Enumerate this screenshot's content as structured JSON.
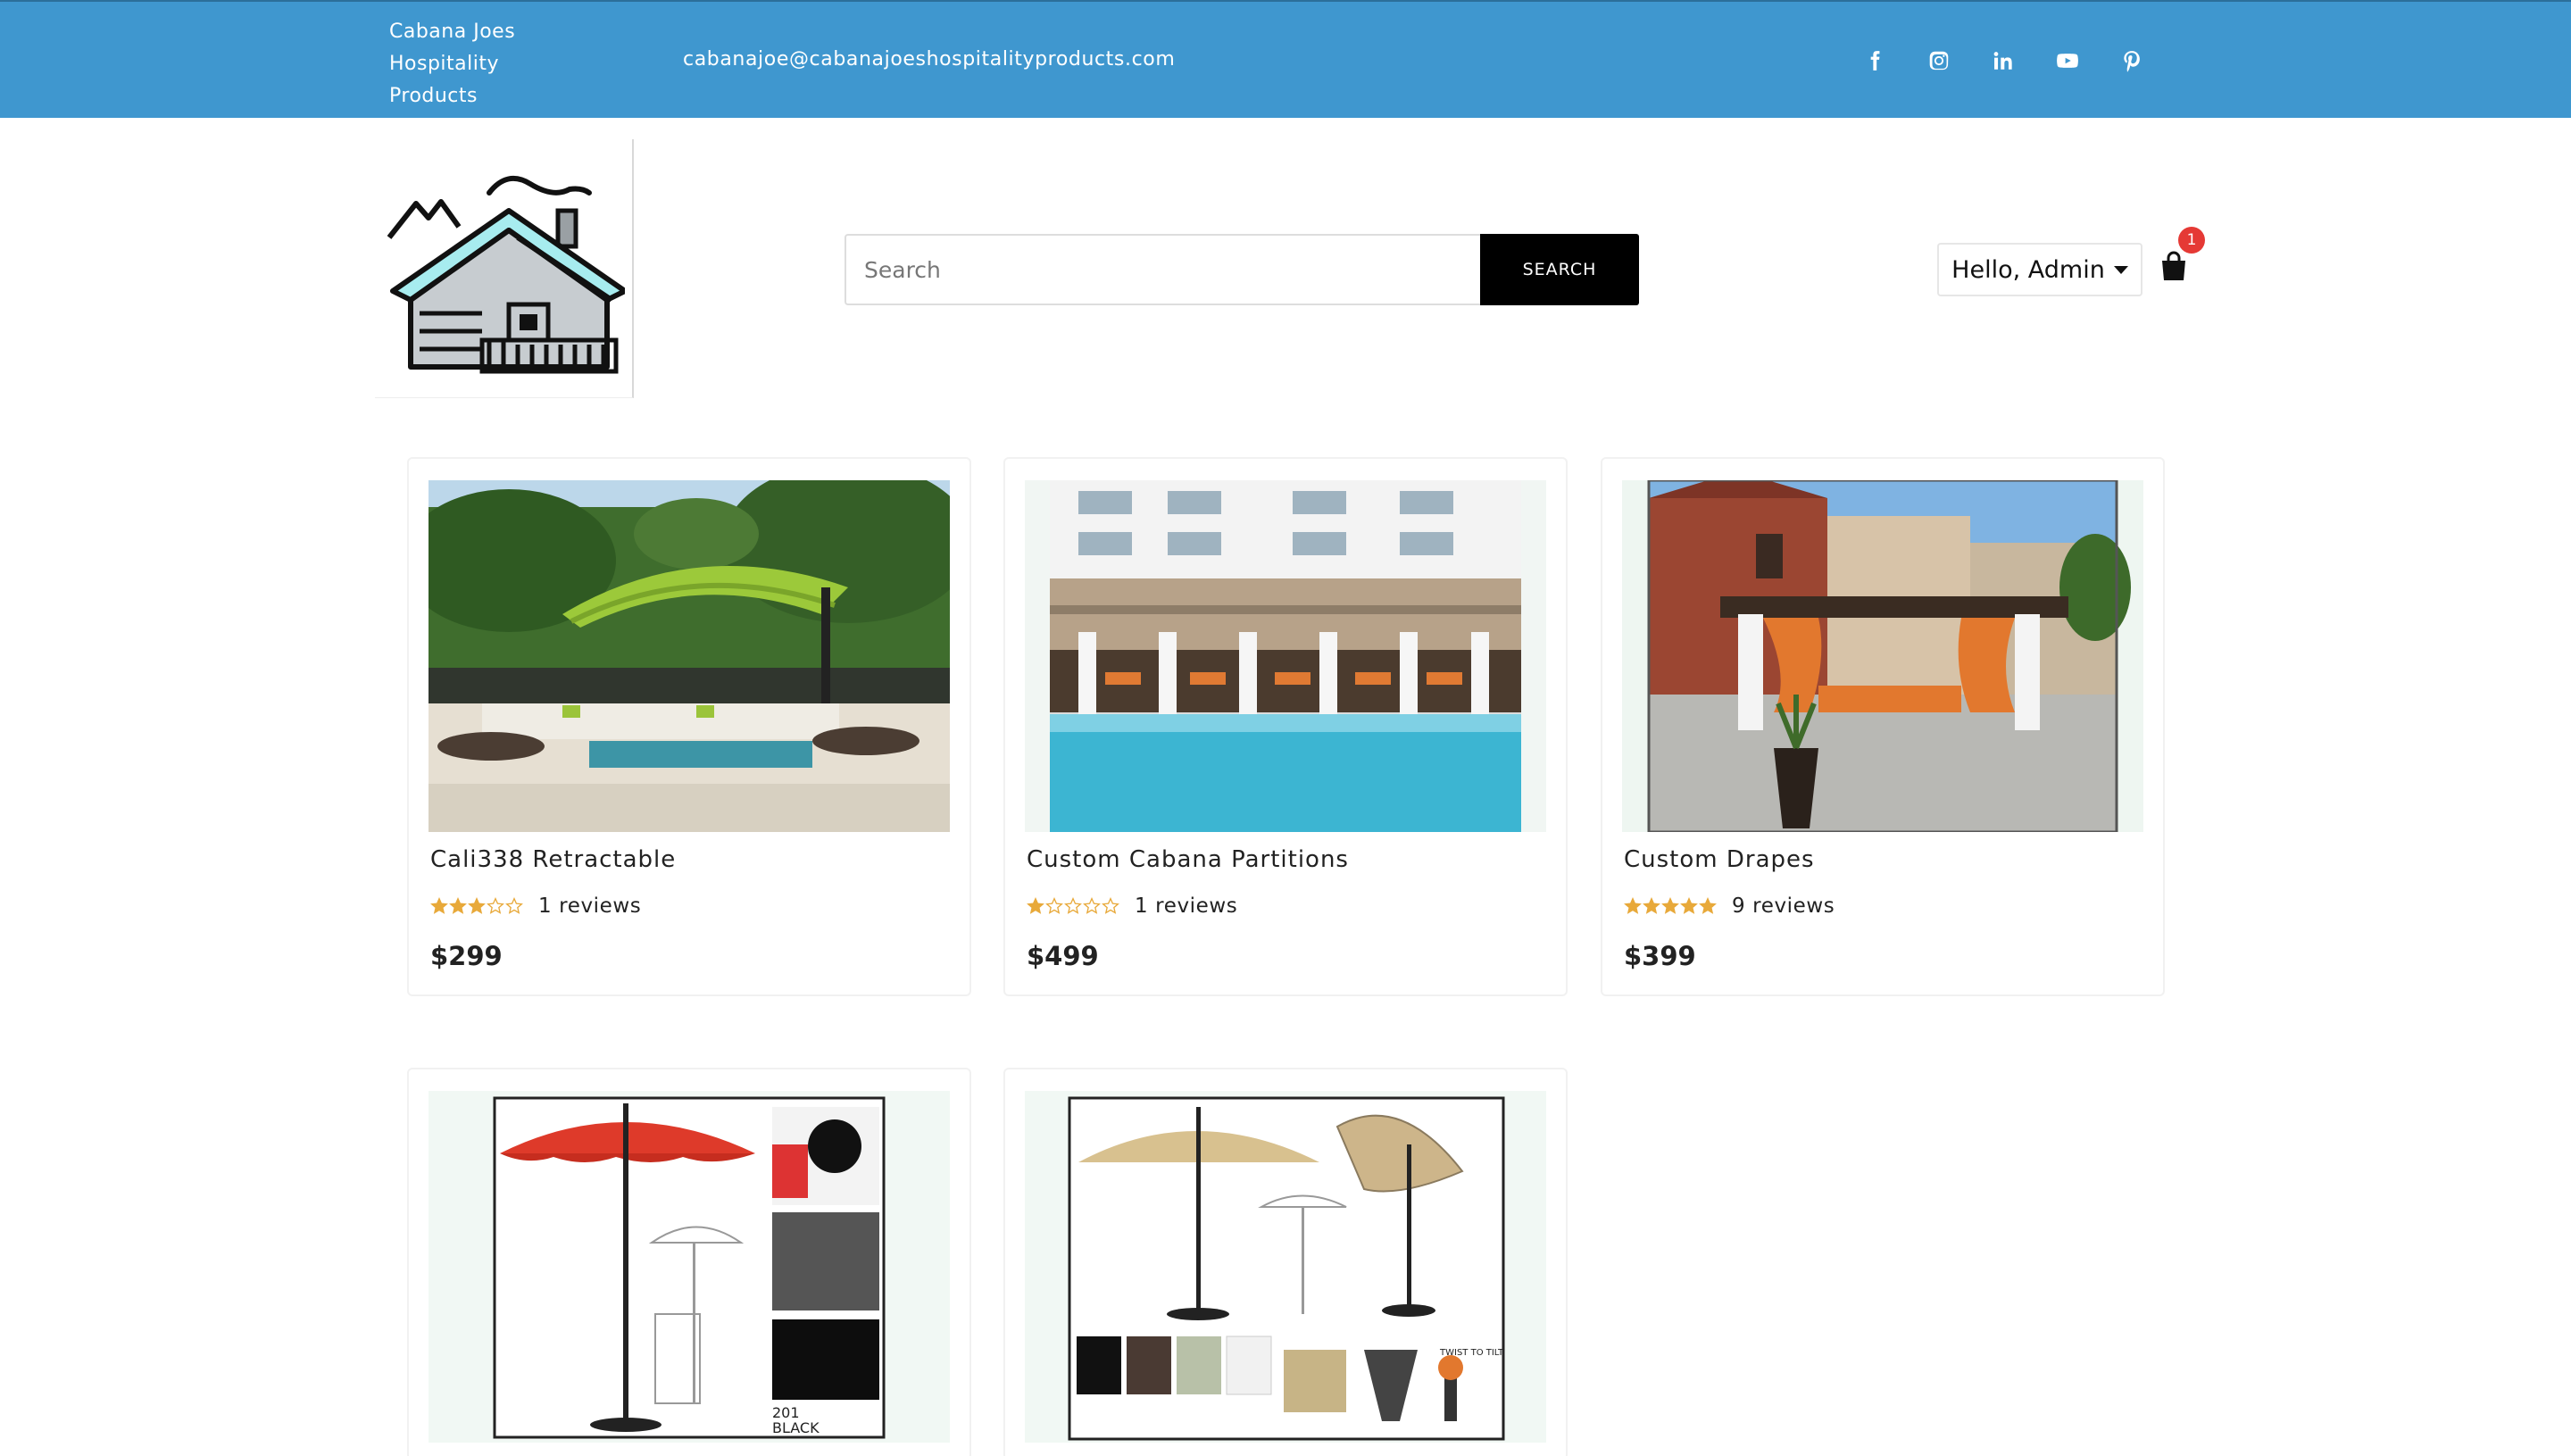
{
  "topbar": {
    "brand_lines": [
      "Cabana Joes",
      "Hospitality",
      "Products"
    ],
    "email": "cabanajoe@cabanajoeshospitalityproducts.com",
    "socials": [
      "facebook-icon",
      "instagram-icon",
      "linkedin-icon",
      "youtube-icon",
      "pinterest-icon"
    ],
    "bg_color": "#3f97cf"
  },
  "header": {
    "search_placeholder": "Search",
    "search_button": "SEARCH",
    "user_greeting": "Hello, Admin",
    "cart_count": "1"
  },
  "products": [
    {
      "title": "Cali338 Retractable",
      "rating": 3,
      "reviews": "1 reviews",
      "price": "$299",
      "image": "green-cantilever-umbrella-pool"
    },
    {
      "title": "Custom Cabana Partitions",
      "rating": 1,
      "reviews": "1 reviews",
      "price": "$499",
      "image": "hotel-pool-cabanas"
    },
    {
      "title": "Custom Drapes",
      "rating": 5,
      "reviews": "9 reviews",
      "price": "$399",
      "image": "orange-drapes-pergola"
    },
    {
      "title": "",
      "image": "red-market-umbrella"
    },
    {
      "title": "",
      "image": "beige-market-umbrella"
    }
  ],
  "colors": {
    "star": "#e8a93a",
    "badge": "#e53935",
    "button": "#000000"
  }
}
